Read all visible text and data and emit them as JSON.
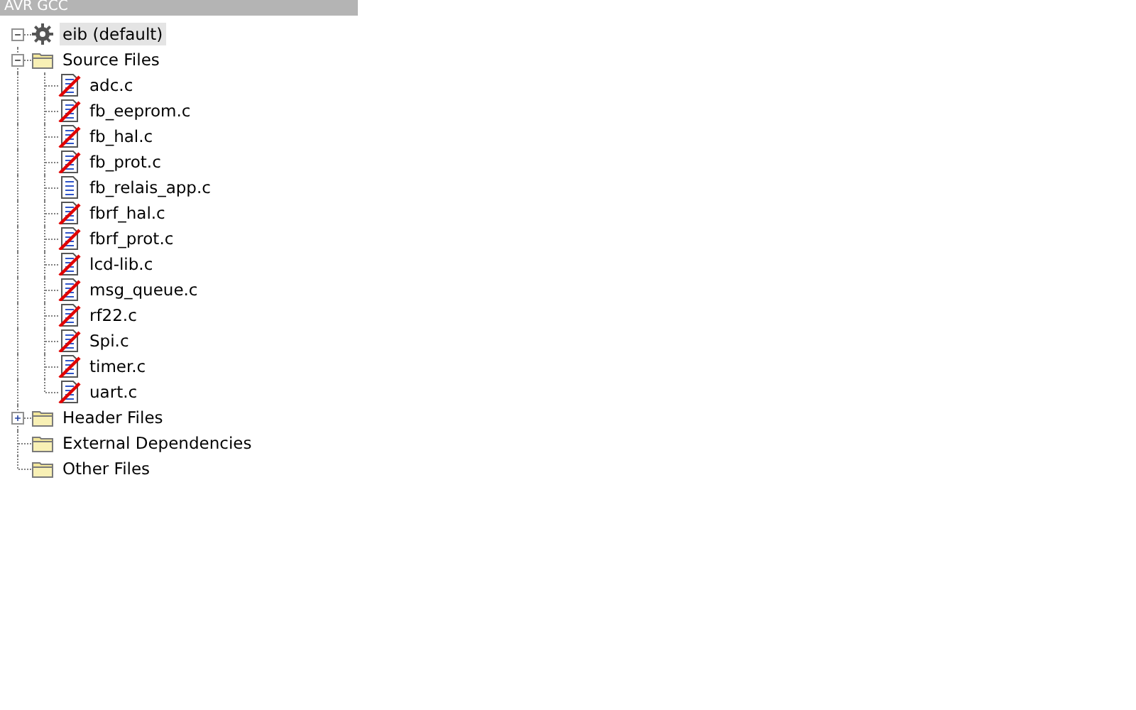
{
  "panel": {
    "title": "AVR GCC"
  },
  "tree": [
    {
      "label": "eib (default)",
      "kind": "project",
      "selected": true,
      "expanded": true,
      "children": [
        {
          "label": "Source Files",
          "kind": "folder",
          "selected": false,
          "expanded": true,
          "children": [
            {
              "label": "adc.c",
              "kind": "file",
              "selected": false,
              "excluded": true
            },
            {
              "label": "fb_eeprom.c",
              "kind": "file",
              "selected": false,
              "excluded": true
            },
            {
              "label": "fb_hal.c",
              "kind": "file",
              "selected": false,
              "excluded": true
            },
            {
              "label": "fb_prot.c",
              "kind": "file",
              "selected": false,
              "excluded": true
            },
            {
              "label": "fb_relais_app.c",
              "kind": "file",
              "selected": false,
              "excluded": false
            },
            {
              "label": "fbrf_hal.c",
              "kind": "file",
              "selected": false,
              "excluded": true
            },
            {
              "label": "fbrf_prot.c",
              "kind": "file",
              "selected": false,
              "excluded": true
            },
            {
              "label": "lcd-lib.c",
              "kind": "file",
              "selected": false,
              "excluded": true
            },
            {
              "label": "msg_queue.c",
              "kind": "file",
              "selected": false,
              "excluded": true
            },
            {
              "label": "rf22.c",
              "kind": "file",
              "selected": false,
              "excluded": true
            },
            {
              "label": "Spi.c",
              "kind": "file",
              "selected": false,
              "excluded": true
            },
            {
              "label": "timer.c",
              "kind": "file",
              "selected": false,
              "excluded": true
            },
            {
              "label": "uart.c",
              "kind": "file",
              "selected": false,
              "excluded": true
            }
          ]
        },
        {
          "label": "Header Files",
          "kind": "folder",
          "selected": false,
          "expanded": false
        },
        {
          "label": "External Dependencies",
          "kind": "folder",
          "selected": false
        },
        {
          "label": "Other Files",
          "kind": "folder",
          "selected": false
        }
      ]
    }
  ]
}
